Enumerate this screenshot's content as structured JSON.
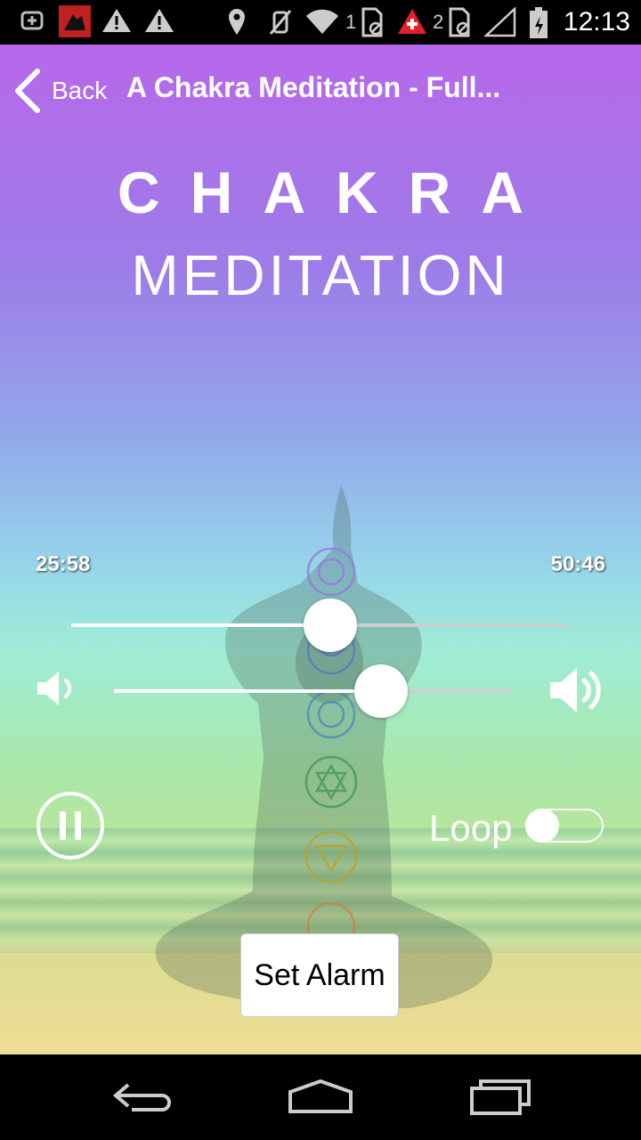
{
  "status_bar": {
    "time": "12:13",
    "sim1_label": "1",
    "sim2_label": "2",
    "icons": [
      "add-icon",
      "app-notification-icon",
      "warning-icon",
      "warning-icon",
      "location-icon",
      "mute-icon",
      "wifi-icon",
      "sim-icon",
      "medical-icon",
      "sim-icon",
      "signal-icon",
      "battery-icon"
    ]
  },
  "header": {
    "back_label": "Back",
    "title": "A Chakra Meditation - Full..."
  },
  "artwork": {
    "line1": "CHAKRA",
    "line2": "MEDITATION"
  },
  "player": {
    "current_time": "25:58",
    "total_time": "50:46",
    "progress": 0.52,
    "volume": 0.67,
    "state": "playing"
  },
  "loop": {
    "label": "Loop",
    "enabled": false
  },
  "alarm": {
    "label": "Set Alarm"
  },
  "colors": {
    "top_gradient": "#b768ea",
    "mid_gradient": "#96d6ea",
    "bottom_gradient": "#e8dc8a"
  }
}
